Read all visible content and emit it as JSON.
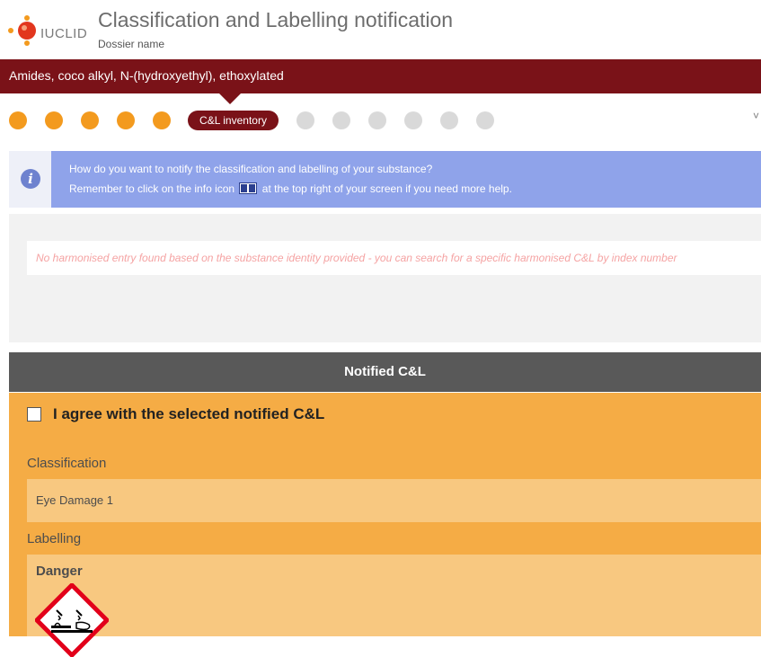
{
  "header": {
    "logo_text": "IUCLID",
    "title": "Classification and Labelling notification",
    "subtitle": "Dossier name"
  },
  "substance": {
    "name": "Amides, coco alkyl, N-(hydroxyethyl), ethoxylated"
  },
  "stepper": {
    "completed_steps": 5,
    "active_label": "C&L inventory",
    "remaining_steps": 6,
    "colors": {
      "done": "#f39a1e",
      "active": "#7a1218",
      "todo": "#d9d9d9"
    }
  },
  "info": {
    "icon": "info-icon",
    "line1": "How do you want to notify the classification and labelling of your substance?",
    "line2_before": "Remember to click on the info icon",
    "line2_icon": "book-icon",
    "line2_after": "at the top right of your screen if you need more help."
  },
  "harmonised": {
    "message": "No harmonised entry found based on the substance identity provided - you can search for a specific harmonised C&L by index number"
  },
  "notified": {
    "section_title": "Notified C&L",
    "agree_label": "I agree with the selected notified C&L",
    "agree_checked": false,
    "classification_label": "Classification",
    "classification_value": "Eye Damage 1",
    "labelling_label": "Labelling",
    "signal_word": "Danger",
    "pictogram": "ghs-corrosion-icon"
  },
  "colors": {
    "brand_dark_red": "#7a1218",
    "accent_orange": "#f5ac45",
    "info_blue": "#8fa3ea",
    "section_header_gray": "#595959"
  }
}
